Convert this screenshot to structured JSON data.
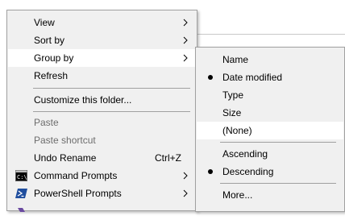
{
  "main_menu": {
    "view": "View",
    "sort_by": "Sort by",
    "group_by": "Group by",
    "refresh": "Refresh",
    "customize": "Customize this folder...",
    "paste": "Paste",
    "paste_shortcut": "Paste shortcut",
    "undo_rename": "Undo Rename",
    "undo_rename_shortcut": "Ctrl+Z",
    "command_prompts": "Command Prompts",
    "powershell_prompts": "PowerShell Prompts"
  },
  "group_by_menu": {
    "name": "Name",
    "date_modified": "Date modified",
    "type": "Type",
    "size": "Size",
    "none": "(None)",
    "ascending": "Ascending",
    "descending": "Descending",
    "more": "More..."
  },
  "colors": {
    "menu_bg": "#f0f0f0",
    "highlight_bg": "#ffffff",
    "disabled_text": "#6d6d6d",
    "separator": "#a0a0a0",
    "powershell_blue": "#1f4e9e"
  }
}
